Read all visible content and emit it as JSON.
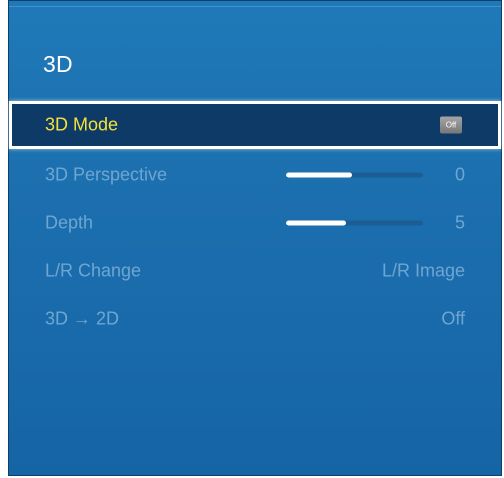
{
  "menu": {
    "title": "3D",
    "items": [
      {
        "label": "3D Mode",
        "value": "Off",
        "selected": true
      },
      {
        "label": "3D Perspective",
        "value": "0",
        "slider_fill_fraction": 0.48
      },
      {
        "label": "Depth",
        "value": "5",
        "slider_fill_fraction": 0.44
      },
      {
        "label": "L/R Change",
        "value": "L/R Image"
      },
      {
        "label": "3D → 2D",
        "value": "Off"
      }
    ]
  },
  "colors": {
    "panel_background": "#1c6fae",
    "selected_background": "#0d3a66",
    "selected_label": "#f5e13a",
    "inactive_text": "#6ea6d2",
    "off_badge": "#8c8c8c"
  }
}
